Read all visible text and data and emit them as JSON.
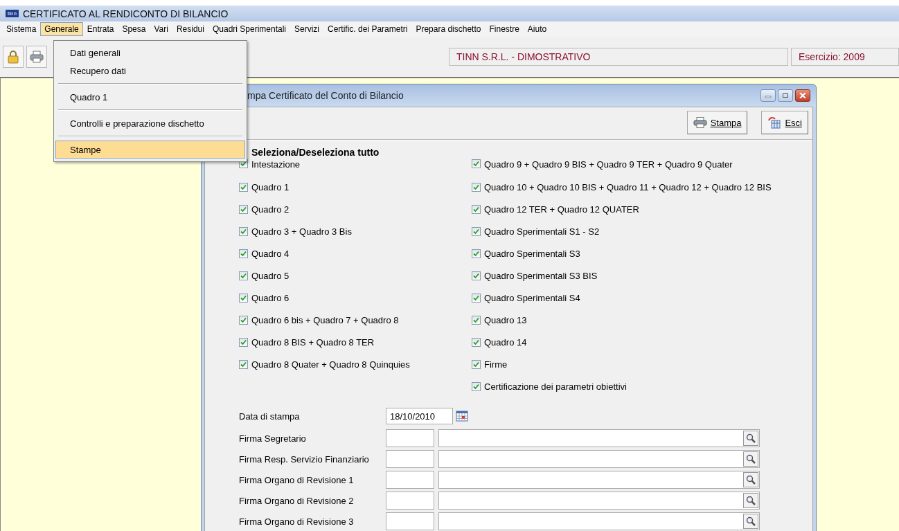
{
  "app": {
    "title": "CERTIFICATO AL RENDICONTO DI BILANCIO",
    "logo": "tinn"
  },
  "menu_bar": [
    {
      "label": "Sistema",
      "selected": false
    },
    {
      "label": "Generale",
      "selected": true
    },
    {
      "label": "Entrata",
      "selected": false
    },
    {
      "label": "Spesa",
      "selected": false
    },
    {
      "label": "Vari",
      "selected": false
    },
    {
      "label": "Residui",
      "selected": false
    },
    {
      "label": "Quadri Sperimentali",
      "selected": false
    },
    {
      "label": "Servizi",
      "selected": false
    },
    {
      "label": "Certific. dei Parametri",
      "selected": false
    },
    {
      "label": "Prepara dischetto",
      "selected": false
    },
    {
      "label": "Finestre",
      "selected": false
    },
    {
      "label": "Aiuto",
      "selected": false
    }
  ],
  "dropdown": [
    {
      "kind": "item",
      "label": "Dati generali",
      "selected": false
    },
    {
      "kind": "item",
      "label": "Recupero dati",
      "selected": false
    },
    {
      "kind": "separator"
    },
    {
      "kind": "item",
      "label": "Quadro 1",
      "selected": false
    },
    {
      "kind": "separator"
    },
    {
      "kind": "item",
      "label": "Controlli e preparazione dischetto",
      "selected": false
    },
    {
      "kind": "separator"
    },
    {
      "kind": "item",
      "label": "Stampe",
      "selected": true
    }
  ],
  "status": {
    "company": "TINN S.R.L. - DIMOSTRATIVO",
    "year": "Esercizio: 2009"
  },
  "window": {
    "title": "mpa Certificato del Conto di Bilancio",
    "buttons": [
      {
        "label": "Stampa",
        "kind": "print"
      },
      {
        "label": "Esci",
        "kind": "exit"
      }
    ],
    "select_all": "Seleziona/Deseleziona tutto",
    "left_column": [
      {
        "label": "Intestazione",
        "checked": true
      },
      {
        "label": "Quadro 1",
        "checked": true
      },
      {
        "label": "Quadro 2",
        "checked": true
      },
      {
        "label": "Quadro 3 + Quadro 3 Bis",
        "checked": true
      },
      {
        "label": "Quadro 4",
        "checked": true
      },
      {
        "label": "Quadro 5",
        "checked": true
      },
      {
        "label": "Quadro 6",
        "checked": true
      },
      {
        "label": "Quadro 6 bis + Quadro 7 + Quadro 8",
        "checked": true
      },
      {
        "label": "Quadro 8 BIS + Quadro 8 TER",
        "checked": true
      },
      {
        "label": "Quadro 8 Quater + Quadro 8 Quinquies",
        "checked": true
      }
    ],
    "right_column": [
      {
        "label": "Quadro 9 + Quadro 9 BIS + Quadro 9 TER + Quadro 9 Quater",
        "checked": true
      },
      {
        "label": "Quadro 10 + Quadro 10 BIS + Quadro 11 + Quadro 12 + Quadro 12 BIS",
        "checked": true
      },
      {
        "label": "Quadro 12 TER + Quadro 12 QUATER",
        "checked": true
      },
      {
        "label": "Quadro Sperimentali S1 - S2",
        "checked": true
      },
      {
        "label": "Quadro Sperimentali S3",
        "checked": true
      },
      {
        "label": "Quadro Sperimentali S3 BIS",
        "checked": true
      },
      {
        "label": "Quadro Sperimentali S4",
        "checked": true
      },
      {
        "label": "Quadro 13",
        "checked": true
      },
      {
        "label": "Quadro 14",
        "checked": true
      },
      {
        "label": "Firme",
        "checked": true
      },
      {
        "label": "Certificazione dei parametri obiettivi",
        "checked": true
      }
    ],
    "print_date": {
      "label": "Data di stampa",
      "value": "18/10/2010"
    },
    "signatures": [
      {
        "label": "Firma Segretario"
      },
      {
        "label": "Firma Resp. Servizio Finanziario"
      },
      {
        "label": "Firma Organo di Revisione 1"
      },
      {
        "label": "Firma Organo di Revisione 2"
      },
      {
        "label": "Firma Organo di Revisione 3"
      }
    ]
  }
}
